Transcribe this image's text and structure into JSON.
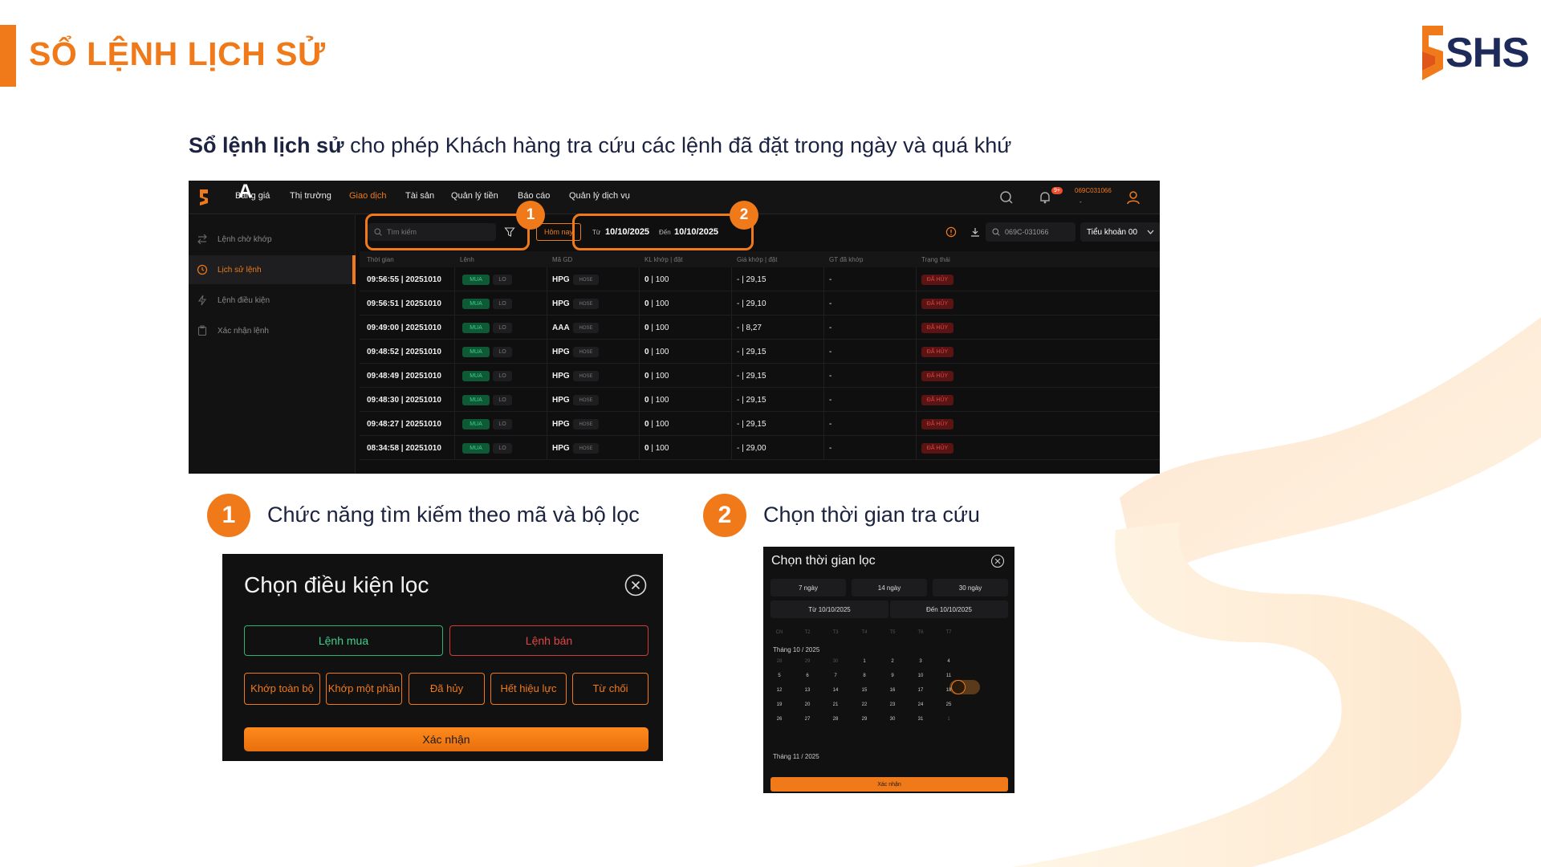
{
  "page": {
    "title": "SỔ LỆNH LỊCH SỬ",
    "brand": "SHS",
    "intro_bold": "Sổ lệnh lịch sử",
    "intro_rest": " cho phép Khách hàng tra cứu các lệnh đã đặt trong ngày và quá khứ",
    "accent_color": "#f07a1a"
  },
  "app": {
    "cursor_letter": "A",
    "nav": [
      "Bảng giá",
      "Thị trường",
      "Giao dịch",
      "Tài sản",
      "Quản lý tiền",
      "Báo cáo",
      "Quản lý dịch vụ"
    ],
    "nav_active": "Giao dịch",
    "notif_badge": "9+",
    "account_top": "069C031066",
    "account_top_sub": "-",
    "sidebar": [
      "Lệnh chờ khớp",
      "Lịch sử lệnh",
      "Lệnh điều kiện",
      "Xác nhận lệnh"
    ],
    "sidebar_active": "Lịch sử lệnh",
    "search_placeholder": "Tìm kiếm",
    "today_label": "Hôm nay",
    "from_label": "Từ",
    "from_date": "10/10/2025",
    "to_label": "Đến",
    "to_date": "10/10/2025",
    "account_search": "069C-031066",
    "account_select": "Tiểu khoản 00",
    "callout_1": "1",
    "callout_2": "2",
    "columns": [
      "Thời gian",
      "Lệnh",
      "Mã GD",
      "KL khớp | đặt",
      "Giá khớp | đặt",
      "GT đã khớp",
      "Trạng thái"
    ],
    "rows": [
      {
        "time": "09:56:55 | 20251010",
        "side": "MUA",
        "type": "LO",
        "symbol": "HPG",
        "exchange": "HOSE",
        "qty_bold": "0",
        "qty": " | 100",
        "price": "- | 29,15",
        "value": "-",
        "status": "ĐÃ HỦY"
      },
      {
        "time": "09:56:51 | 20251010",
        "side": "MUA",
        "type": "LO",
        "symbol": "HPG",
        "exchange": "HOSE",
        "qty_bold": "0",
        "qty": " | 100",
        "price": "- | 29,10",
        "value": "-",
        "status": "ĐÃ HỦY"
      },
      {
        "time": "09:49:00 | 20251010",
        "side": "MUA",
        "type": "LO",
        "symbol": "AAA",
        "exchange": "HOSE",
        "qty_bold": "0",
        "qty": " | 100",
        "price": "- | 8,27",
        "value": "-",
        "status": "ĐÃ HỦY"
      },
      {
        "time": "09:48:52 | 20251010",
        "side": "MUA",
        "type": "LO",
        "symbol": "HPG",
        "exchange": "HOSE",
        "qty_bold": "0",
        "qty": " | 100",
        "price": "- | 29,15",
        "value": "-",
        "status": "ĐÃ HỦY"
      },
      {
        "time": "09:48:49 | 20251010",
        "side": "MUA",
        "type": "LO",
        "symbol": "HPG",
        "exchange": "HOSE",
        "qty_bold": "0",
        "qty": " | 100",
        "price": "- | 29,15",
        "value": "-",
        "status": "ĐÃ HỦY"
      },
      {
        "time": "09:48:30 | 20251010",
        "side": "MUA",
        "type": "LO",
        "symbol": "HPG",
        "exchange": "HOSE",
        "qty_bold": "0",
        "qty": " | 100",
        "price": "- | 29,15",
        "value": "-",
        "status": "ĐÃ HỦY"
      },
      {
        "time": "09:48:27 | 20251010",
        "side": "MUA",
        "type": "LO",
        "symbol": "HPG",
        "exchange": "HOSE",
        "qty_bold": "0",
        "qty": " | 100",
        "price": "- | 29,15",
        "value": "-",
        "status": "ĐÃ HỦY"
      },
      {
        "time": "08:34:58 | 20251010",
        "side": "MUA",
        "type": "LO",
        "symbol": "HPG",
        "exchange": "HOSE",
        "qty_bold": "0",
        "qty": " | 100",
        "price": "- | 29,00",
        "value": "-",
        "status": "ĐÃ HỦY"
      }
    ]
  },
  "captions": {
    "num1": "1",
    "text1": "Chức năng tìm kiếm theo mã và bộ lọc",
    "num2": "2",
    "text2": "Chọn thời gian tra cứu"
  },
  "filter_panel": {
    "title": "Chọn điều kiện lọc",
    "buy": "Lệnh mua",
    "sell": "Lệnh bán",
    "options": [
      "Khớp toàn bộ",
      "Khớp một phần",
      "Đã hủy",
      "Hết hiệu lực",
      "Từ chối"
    ],
    "confirm": "Xác nhận"
  },
  "date_panel": {
    "title": "Chọn thời gian lọc",
    "quick": [
      "7 ngày",
      "14 ngày",
      "30 ngày"
    ],
    "from": "Từ 10/10/2025",
    "to": "Đến 10/10/2025",
    "weekdays": [
      "CN",
      "T2",
      "T3",
      "T4",
      "T5",
      "T6",
      "T7"
    ],
    "month1": "Tháng 10 / 2025",
    "weeks": [
      [
        "28",
        "29",
        "30",
        "1",
        "2",
        "3",
        "4"
      ],
      [
        "5",
        "6",
        "7",
        "8",
        "9",
        "10",
        "11"
      ],
      [
        "12",
        "13",
        "14",
        "15",
        "16",
        "17",
        "18"
      ],
      [
        "19",
        "20",
        "21",
        "22",
        "23",
        "24",
        "25"
      ],
      [
        "26",
        "27",
        "28",
        "29",
        "30",
        "31",
        "1"
      ]
    ],
    "selected_day": "10",
    "month2": "Tháng 11 / 2025",
    "confirm": "Xác nhận"
  }
}
